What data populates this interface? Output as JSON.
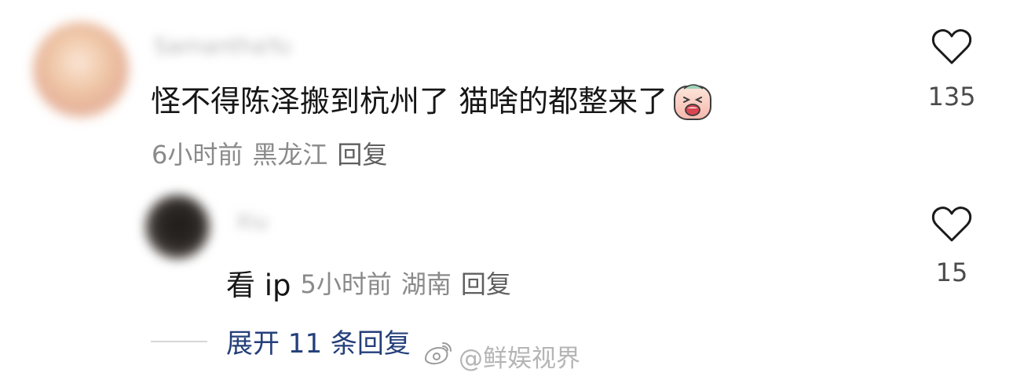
{
  "comment": {
    "username": "SamanthaYu",
    "text": "怪不得陈泽搬到杭州了 猫啥的都整来了",
    "emoji_icon": "crying-face-emoji-icon",
    "time": "6小时前",
    "location": "黑龙江",
    "reply_label": "回复",
    "likes": "135"
  },
  "reply": {
    "username": "Xiu",
    "prefix": "看 ip",
    "time": "5小时前",
    "location": "湖南",
    "reply_label": "回复",
    "likes": "15"
  },
  "expand": {
    "label": "展开 11 条回复"
  },
  "watermark": {
    "text": "@鲜娱视界",
    "icon": "weibo-logo-icon"
  },
  "colors": {
    "text_primary": "#161616",
    "text_secondary": "#8a8a8a",
    "link_blue": "#243f7a",
    "heart_stroke": "#1a1a1a"
  }
}
